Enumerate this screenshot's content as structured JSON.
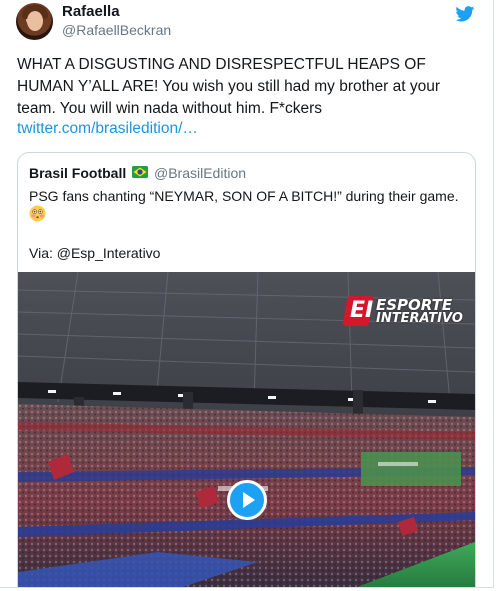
{
  "author": {
    "name": "Rafaella",
    "handle": "@RafaellBeckran"
  },
  "tweet": {
    "text": "WHAT A DISGUSTING AND DISRESPECTFUL HEAPS OF HUMAN Y’ALL ARE! You wish you still had my brother at your team. You will win nada without him. F*ckers",
    "link": "twitter.com/brasiledition/…"
  },
  "quoted": {
    "name": "Brasil Football",
    "flag": "brazil-flag-icon",
    "handle": "@BrasilEdition",
    "text": "PSG fans chanting “NEYMAR, SON OF A BITCH!” during their game.",
    "emoji": "flushed-face-icon",
    "via": "Via: @Esp_Interativo"
  },
  "media": {
    "logo_line1": "ESPORTE",
    "logo_line2": "INTERATIVO",
    "logo_letter": "EI",
    "play_icon": "play-icon"
  },
  "colors": {
    "link": "#1b95e0",
    "twitter_blue": "#1da1f2",
    "secondary_text": "#657786",
    "border": "#ccd6dd",
    "logo_red": "#d3172d"
  }
}
